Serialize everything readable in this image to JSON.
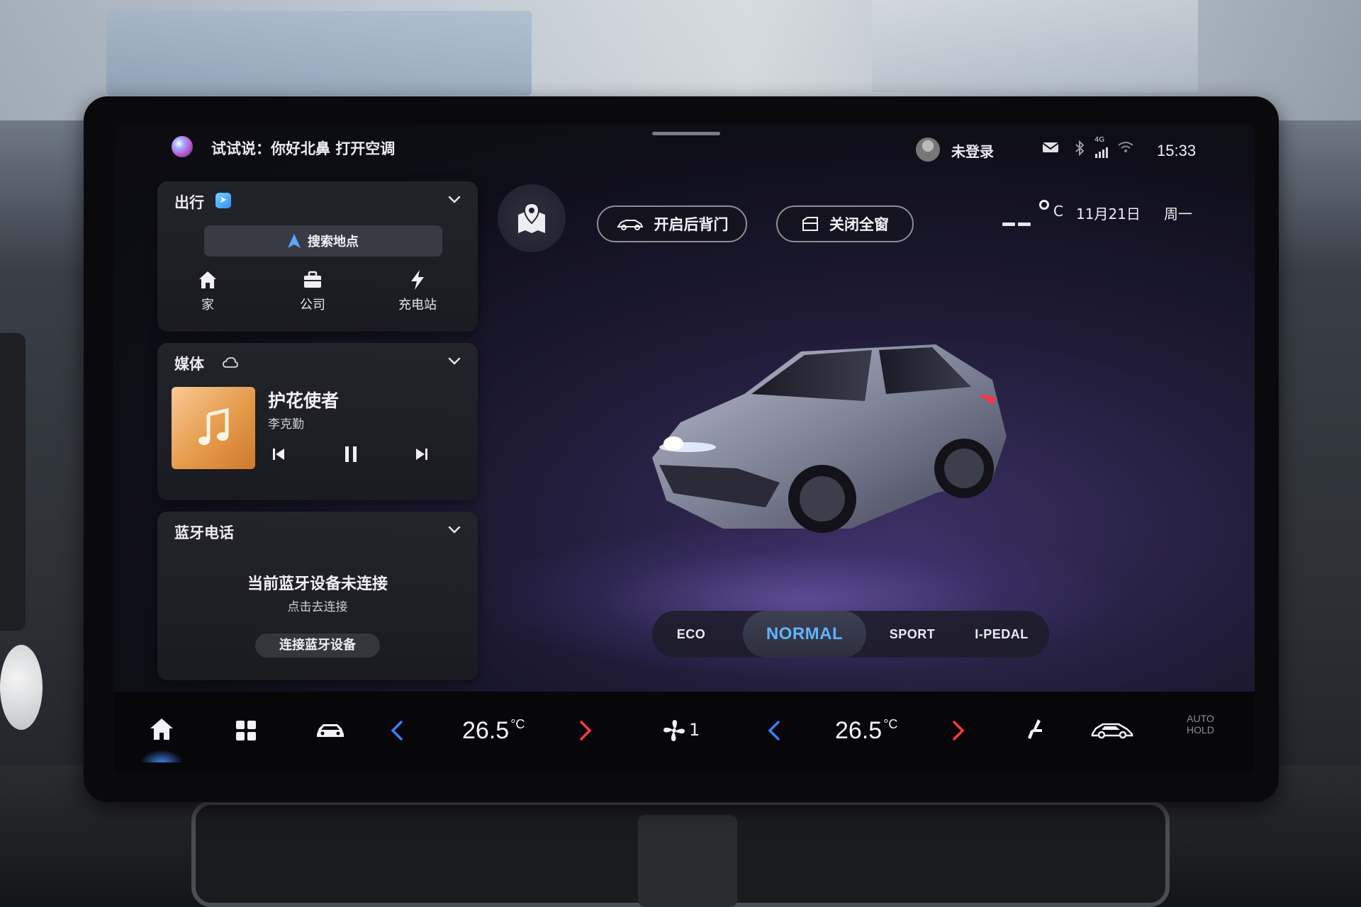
{
  "status_bar": {
    "voice_hint": "试试说：你好北鼻 打开空调",
    "login_label": "未登录",
    "network_label": "4G",
    "time": "15:33"
  },
  "navigation_card": {
    "title": "出行",
    "search_label": "搜索地点",
    "shortcuts": [
      {
        "label": "家",
        "icon": "home-icon"
      },
      {
        "label": "公司",
        "icon": "briefcase-icon"
      },
      {
        "label": "充电站",
        "icon": "lightning-icon"
      }
    ]
  },
  "media_card": {
    "title": "媒体",
    "song_title": "护花使者",
    "artist": "李克勤"
  },
  "bluetooth_card": {
    "title": "蓝牙电话",
    "status": "当前蓝牙设备未连接",
    "hint": "点击去连接",
    "connect_label": "连接蓝牙设备"
  },
  "vehicle_controls": {
    "tailgate_label": "开启后背门",
    "windows_label": "关闭全窗"
  },
  "weather": {
    "temp_unit": "C",
    "date": "11月21日",
    "weekday": "周一"
  },
  "drive_modes": {
    "items": [
      "ECO",
      "NORMAL",
      "SPORT",
      "I-PEDAL"
    ],
    "selected": "NORMAL"
  },
  "climate": {
    "left_temp": "26.5",
    "right_temp": "26.5",
    "temp_unit": "°C",
    "fan_level": "1",
    "auto_hold_line1": "AUTO",
    "auto_hold_line2": "HOLD"
  },
  "colors": {
    "accent_blue": "#5db4ff",
    "decrease_arrow": "#3d7bff",
    "increase_arrow": "#ff3b3b",
    "album_orange": "#e59a4a"
  }
}
